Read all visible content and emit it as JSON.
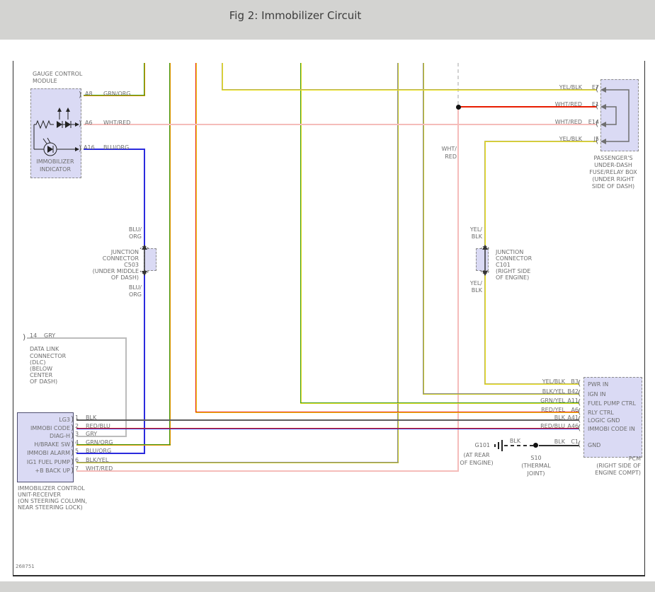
{
  "title": "Fig 2: Immobilizer Circuit",
  "figure_code": "268751",
  "colors": {
    "wire_green": "#3f9e1c",
    "wire_orange": "#e59400",
    "wire_red": "#e81c00",
    "wire_yellow": "#e9df25",
    "wire_olive": "#c9c922",
    "wire_blue": "#2b2bdd",
    "wire_pink": "#f5bcba",
    "wire_gray": "#bcbcbc",
    "wire_black": "#5c5c5c",
    "stripe_dark": "#8e8e8e",
    "box_fill": "#dadaf4",
    "box_border": "#8c8c8c",
    "unit_border": "#4e4e70",
    "text_gray": "#6d6d6d",
    "page_gray": "#d3d3d1",
    "ink": "#2e2e2e"
  },
  "gauge_module": {
    "name": [
      "GAUGE CONTROL",
      "MODULE"
    ],
    "indicator": [
      "IMMOBILIZER",
      "INDICATOR"
    ],
    "pins": [
      {
        "pin": "A8",
        "wire": "GRN/ORG"
      },
      {
        "pin": "A6",
        "wire": "WHT/RED"
      },
      {
        "pin": "A16",
        "wire": "BLU/ORG"
      }
    ]
  },
  "fuse_box": {
    "pins": [
      {
        "wire": "YEL/BLK",
        "pin": "E7"
      },
      {
        "wire": "WHT/RED",
        "pin": "E1"
      },
      {
        "wire": "WHT/RED",
        "pin": "E14"
      },
      {
        "wire": "YEL/BLK",
        "pin": "J5"
      }
    ],
    "caption": [
      "PASSENGER'S",
      "UNDER-DASH",
      "FUSE/RELAY BOX",
      "(UNDER RIGHT",
      "SIDE OF DASH)"
    ]
  },
  "junction_c503": {
    "label": [
      "JUNCTION",
      "CONNECTOR",
      "C503",
      "(UNDER MIDDLE",
      "OF DASH)"
    ],
    "wire_above": [
      "BLU/",
      "ORG"
    ],
    "wire_below": [
      "BLU/",
      "ORG"
    ]
  },
  "junction_c101": {
    "label": [
      "JUNCTION",
      "CONNECTOR",
      "C101",
      "(RIGHT SIDE",
      "OF ENGINE)"
    ],
    "wire_above": [
      "YEL/",
      "BLK"
    ],
    "wire_below": [
      "YEL/",
      "BLK"
    ]
  },
  "mid_wire_label": [
    "WHT/",
    "RED"
  ],
  "dlc": {
    "pin": "14",
    "wire": "GRY",
    "caption": [
      "DATA LINK",
      "CONNECTOR",
      "(DLC)",
      "(BELOW",
      "CENTER",
      "OF DASH)"
    ]
  },
  "immobilizer_unit": {
    "pins": [
      {
        "label": "LG3",
        "num": "1",
        "wire": "BLK"
      },
      {
        "label": "IMMOBI CODE",
        "num": "2",
        "wire": "RED/BLU"
      },
      {
        "label": "DIAG-H",
        "num": "3",
        "wire": "GRY"
      },
      {
        "label": "H/BRAKE SW",
        "num": "4",
        "wire": "GRN/ORG"
      },
      {
        "label": "IMMOBI ALARM",
        "num": "5",
        "wire": "BLU/ORG"
      },
      {
        "label": "IG1 FUEL PUMP",
        "num": "6",
        "wire": "BLK/YEL"
      },
      {
        "label": "+B BACK UP",
        "num": "7",
        "wire": "WHT/RED"
      }
    ],
    "caption": [
      "IMMOBILIZER CONTROL",
      "UNIT-RECEIVER",
      "(ON STEERING COLUMN,",
      "NEAR STEERING LOCK)"
    ]
  },
  "pcm": {
    "pins": [
      {
        "wire": "YEL/BLK",
        "pin": "B3",
        "label": "PWR IN"
      },
      {
        "wire": "BLK/YEL",
        "pin": "B42",
        "label": "IGN IN"
      },
      {
        "wire": "GRN/YEL",
        "pin": "A11",
        "label": "FUEL PUMP CTRL"
      },
      {
        "wire": "RED/YEL",
        "pin": "A6",
        "label": "RLY CTRL"
      },
      {
        "wire": "BLK",
        "pin": "A41",
        "label": "LOGIC GND"
      },
      {
        "wire": "RED/BLU",
        "pin": "A46",
        "label": "IMMOBI CODE IN"
      },
      {
        "wire": "BLK",
        "pin": "C1",
        "label": "GND"
      }
    ],
    "caption": [
      "PCM",
      "(RIGHT SIDE OF",
      "ENGINE COMPT)"
    ]
  },
  "ground": {
    "name": "G101",
    "wire": "BLK",
    "caption": [
      "(AT REAR",
      "OF ENGINE)"
    ]
  },
  "splice": {
    "name": "S10",
    "caption": [
      "(THERMAL",
      "JOINT)"
    ]
  }
}
